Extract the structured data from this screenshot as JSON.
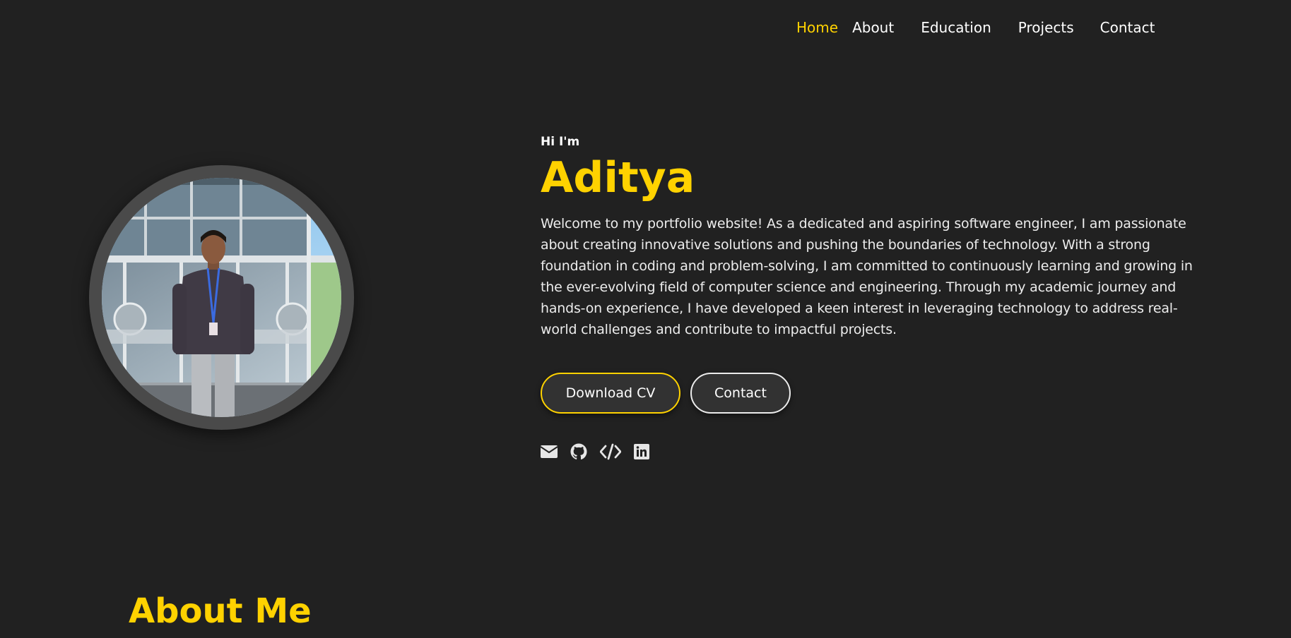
{
  "nav": {
    "items": [
      {
        "label": "Home",
        "active": true
      },
      {
        "label": "About",
        "active": false
      },
      {
        "label": "Education",
        "active": false
      },
      {
        "label": "Projects",
        "active": false
      },
      {
        "label": "Contact",
        "active": false
      }
    ]
  },
  "hero": {
    "greeting": "Hi I'm",
    "name": "Aditya",
    "intro": "Welcome to my portfolio website! As a dedicated and aspiring software engineer, I am passionate about creating innovative solutions and pushing the boundaries of technology. With a strong foundation in coding and problem-solving, I am committed to continuously learning and growing in the ever-evolving field of computer science and engineering. Through my academic journey and hands-on experience, I have developed a keen interest in leveraging technology to address real-world challenges and contribute to impactful projects.",
    "download_cv_label": "Download CV",
    "contact_label": "Contact"
  },
  "socials": [
    {
      "icon": "envelope-icon"
    },
    {
      "icon": "github-icon"
    },
    {
      "icon": "code-icon"
    },
    {
      "icon": "linkedin-icon"
    }
  ],
  "about": {
    "title": "About Me"
  },
  "colors": {
    "background": "#212121",
    "accent": "#ffd200",
    "text": "#ececec",
    "button_bg": "#323232"
  }
}
